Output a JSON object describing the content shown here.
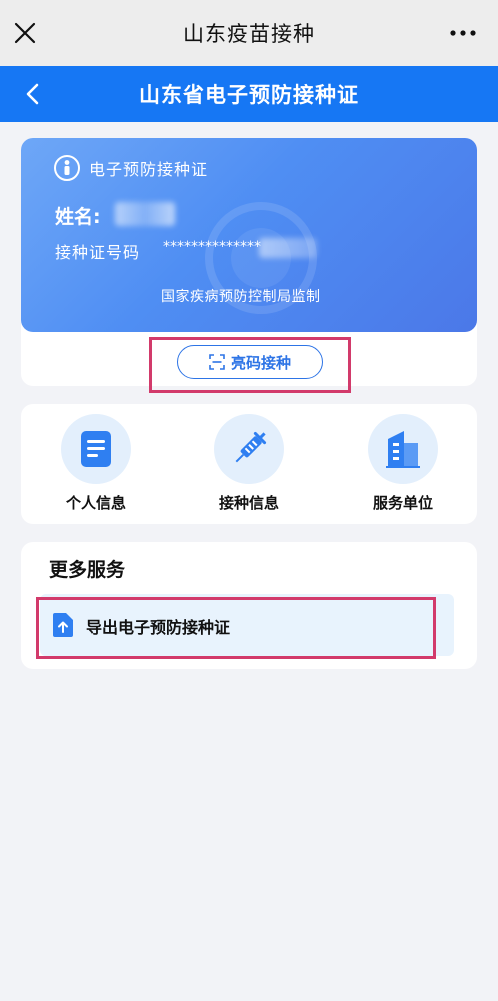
{
  "app_bar": {
    "title": "山东疫苗接种",
    "close_icon": "close-icon",
    "more_icon": "more-dots-icon"
  },
  "header": {
    "title": "山东省电子预防接种证",
    "back_icon": "chevron-left-icon"
  },
  "card": {
    "title": "电子预防接种证",
    "name_label": "姓名:",
    "cert_label": "接种证号码",
    "cert_number": "**************",
    "authority": "国家疾病预防控制局监制"
  },
  "qr_button": {
    "label": "亮码接种",
    "icon": "scan-icon"
  },
  "services": [
    {
      "label": "个人信息",
      "icon": "document-icon"
    },
    {
      "label": "接种信息",
      "icon": "syringe-icon"
    },
    {
      "label": "服务单位",
      "icon": "building-icon"
    }
  ],
  "more_services": {
    "title": "更多服务",
    "items": [
      {
        "label": "导出电子预防接种证",
        "icon": "file-upload-icon"
      }
    ]
  },
  "colors": {
    "primary": "#1677f4",
    "card_gradient_start": "#6ea7f7",
    "card_gradient_end": "#4b78e8",
    "highlight": "#d23a6b",
    "background": "#f2f3f7"
  }
}
